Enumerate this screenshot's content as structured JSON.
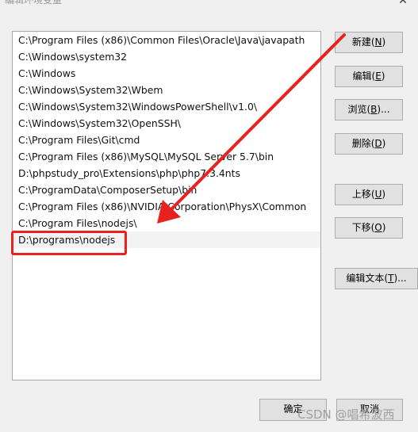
{
  "window": {
    "title": "编辑环境变量",
    "close_glyph": "✕"
  },
  "path_list": {
    "items": [
      "C:\\Program Files (x86)\\Common Files\\Oracle\\Java\\javapath",
      "C:\\Windows\\system32",
      "C:\\Windows",
      "C:\\Windows\\System32\\Wbem",
      "C:\\Windows\\System32\\WindowsPowerShell\\v1.0\\",
      "C:\\Windows\\System32\\OpenSSH\\",
      "C:\\Program Files\\Git\\cmd",
      "C:\\Program Files (x86)\\MySQL\\MySQL Server 5.7\\bin",
      "D:\\phpstudy_pro\\Extensions\\php\\php7.3.4nts",
      "C:\\ProgramData\\ComposerSetup\\bin",
      "C:\\Program Files (x86)\\NVIDIA Corporation\\PhysX\\Common",
      "C:\\Program Files\\nodejs\\",
      "D:\\programs\\nodejs"
    ]
  },
  "buttons": {
    "new": {
      "label": "新建(",
      "key": "N",
      "suffix": ")"
    },
    "edit": {
      "label": "编辑(",
      "key": "E",
      "suffix": ")"
    },
    "browse": {
      "label": "浏览(",
      "key": "B",
      "suffix": ")..."
    },
    "delete": {
      "label": "删除(",
      "key": "D",
      "suffix": ")"
    },
    "move_up": {
      "label": "上移(",
      "key": "U",
      "suffix": ")"
    },
    "move_down": {
      "label": "下移(",
      "key": "O",
      "suffix": ")"
    },
    "edit_text": {
      "label": "编辑文本(",
      "key": "T",
      "suffix": ")..."
    },
    "ok": {
      "label": "确定"
    },
    "cancel": {
      "label": "取消"
    }
  },
  "watermark": "CSDN @唱希波西",
  "annotation": {
    "color": "#e8231f"
  }
}
